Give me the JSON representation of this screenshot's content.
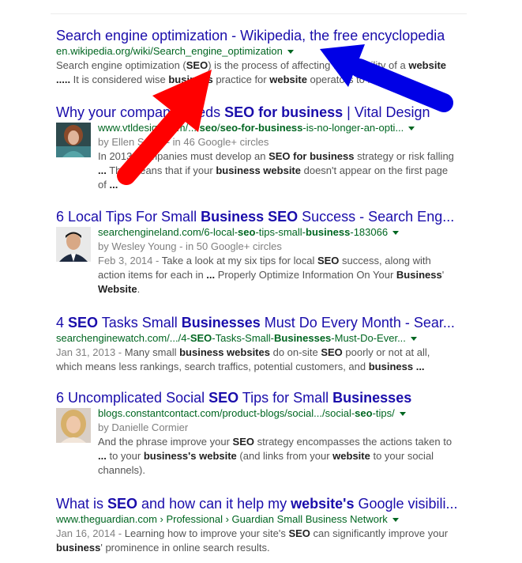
{
  "results": [
    {
      "title": [
        "Search engine optimization - Wikipedia, the free encyclopedia"
      ],
      "url": [
        "en.wikipedia.org/wiki/Search_engine_optimization"
      ],
      "snippet": [
        [
          "Search engine optimization (",
          [
            "SEO"
          ],
          ") is the process of affecting the visibility of a ",
          [
            "website"
          ]
        ],
        [
          [
            "....."
          ],
          " It is considered wise ",
          [
            "business"
          ],
          " practice for ",
          [
            "website"
          ],
          " operators to liberate ",
          [
            "..."
          ]
        ]
      ]
    },
    {
      "title": [
        "Why your company needs ",
        [
          "SEO for business"
        ],
        " | Vital Design"
      ],
      "url": [
        "www.vtldesign.com/.../",
        [
          "seo"
        ],
        "/",
        [
          "seo-for-business"
        ],
        "-is-no-longer-an-opti..."
      ],
      "author": "by Ellen Smith - in 46 Google+ circles",
      "snippet": [
        [
          "In 2013, companies must develop an ",
          [
            "SEO for business"
          ],
          " strategy or risk falling"
        ],
        [
          [
            "..."
          ],
          " This means that if your ",
          [
            "business website"
          ],
          " doesn't appear on the first page"
        ],
        [
          "of ",
          [
            "..."
          ]
        ]
      ]
    },
    {
      "title": [
        "6 Local Tips For Small ",
        [
          "Business SEO"
        ],
        " Success - Search Eng..."
      ],
      "url": [
        "searchengineland.com/6-local-",
        [
          "seo"
        ],
        "-tips-small-",
        [
          "business"
        ],
        "-183066"
      ],
      "author": "by Wesley Young - in 50 Google+ circles",
      "date": "Feb 3, 2014 - ",
      "snippet": [
        [
          "Take a look at my six tips for local ",
          [
            "SEO"
          ],
          " success, along with"
        ],
        [
          "action items for each in ",
          [
            "..."
          ],
          " Properly Optimize Information On Your ",
          [
            "Business"
          ],
          "'"
        ],
        [
          [
            "Website"
          ],
          "."
        ]
      ]
    },
    {
      "title": [
        "4 ",
        [
          "SEO"
        ],
        " Tasks Small ",
        [
          "Businesses"
        ],
        " Must Do Every Month - Sear..."
      ],
      "url": [
        "searchenginewatch.com/.../4-",
        [
          "SEO"
        ],
        "-Tasks-Small-",
        [
          "Businesses"
        ],
        "-Must-Do-Ever..."
      ],
      "date": "Jan 31, 2013 - ",
      "snippet": [
        [
          "Many small ",
          [
            "business websites"
          ],
          " do on-site ",
          [
            "SEO"
          ],
          " poorly or not at all,"
        ],
        [
          "which means less rankings, search traffics, potential customers, and ",
          [
            "business ..."
          ]
        ]
      ]
    },
    {
      "title": [
        "6 Uncomplicated Social ",
        [
          "SEO"
        ],
        " Tips for Small ",
        [
          "Businesses"
        ]
      ],
      "url": [
        "blogs.constantcontact.com/product-blogs/social.../social-",
        [
          "seo"
        ],
        "-tips/"
      ],
      "author": "by Danielle Cormier",
      "snippet": [
        [
          "And the phrase improve your ",
          [
            "SEO"
          ],
          " strategy encompasses the actions taken to"
        ],
        [
          [
            "..."
          ],
          " to your ",
          [
            "business's website"
          ],
          " (and links from your ",
          [
            "website"
          ],
          " to your social"
        ],
        [
          "channels)."
        ]
      ]
    },
    {
      "title": [
        "What is ",
        [
          "SEO"
        ],
        " and how can it help my ",
        [
          "website's"
        ],
        " Google visibili..."
      ],
      "url": [
        "www.theguardian.com › Professional › Guardian Small Business Network"
      ],
      "date": "Jan 16, 2014 - ",
      "snippet": [
        [
          "Learning how to improve your site's ",
          [
            "SEO"
          ],
          " can significantly improve your"
        ],
        [
          [
            "business"
          ],
          "' prominence in online search results."
        ]
      ]
    }
  ],
  "annotation_colors": {
    "red_arrow": "#ff0000",
    "blue_arrow": "#0000e6"
  }
}
